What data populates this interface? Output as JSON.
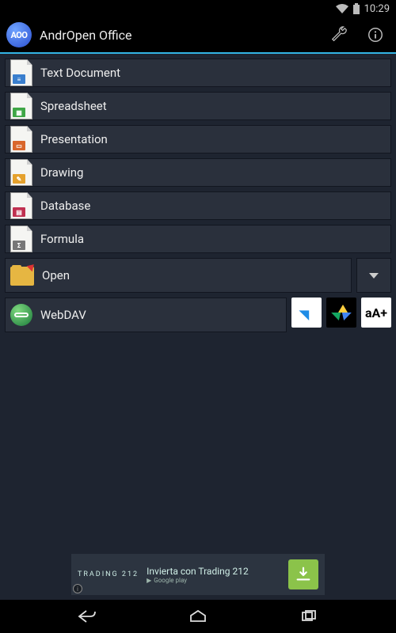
{
  "status": {
    "time": "10:29"
  },
  "appbar": {
    "logo_text": "AOO",
    "title": "AndrOpen Office"
  },
  "menu": {
    "items": [
      {
        "label": "Text Document"
      },
      {
        "label": "Spreadsheet"
      },
      {
        "label": "Presentation"
      },
      {
        "label": "Drawing"
      },
      {
        "label": "Database"
      },
      {
        "label": "Formula"
      }
    ],
    "open_label": "Open",
    "webdav_label": "WebDAV",
    "font_button": "aA+"
  },
  "ad": {
    "brand": "TRADING 212",
    "text": "Invierta con Trading 212",
    "store": "Google play"
  }
}
